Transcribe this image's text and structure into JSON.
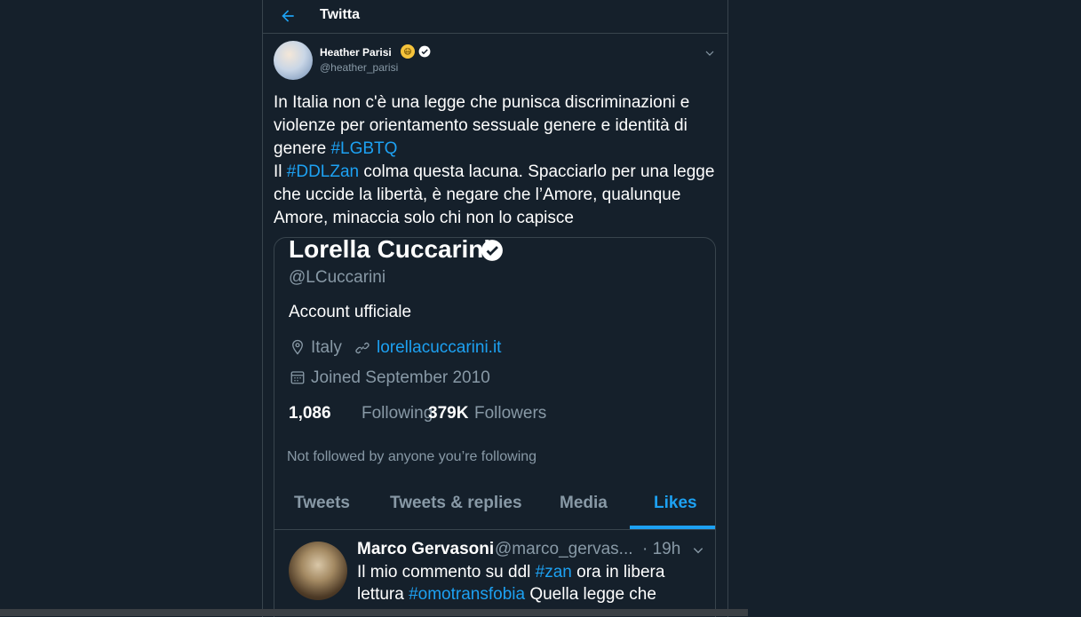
{
  "header": {
    "title": "Twitta"
  },
  "tweet": {
    "author_name": "Heather Parisi",
    "author_emoji": "😷",
    "author_handle": "@heather_parisi",
    "text": {
      "p1": "In Italia non c'è una legge che punisca discriminazioni e violenze per orientamento sessuale genere e identità di genere ",
      "h1": "#LGBTQ",
      "p2a": "Il ",
      "h2": "#DDLZan",
      "p2b": " colma questa lacuna. Spacciarlo per una legge che uccide la libertà, è negare che l’Amore, qualunque Amore, minaccia solo chi non lo capisce"
    }
  },
  "quoted_profile": {
    "name": "Lorella Cuccarini",
    "handle": "@LCuccarini",
    "bio": "Account ufficiale",
    "location": "Italy",
    "link": "lorellacuccarini.it",
    "joined": "Joined September 2010",
    "following_count": "1,086",
    "following_label": "Following",
    "followers_count": "379K",
    "followers_label": "Followers",
    "not_followed_text": "Not followed by anyone you’re following",
    "tabs": [
      "Tweets",
      "Tweets & replies",
      "Media",
      "Likes"
    ],
    "active_tab": "Likes"
  },
  "liked_tweet": {
    "name": "Marco Gervasoni",
    "handle": "@marco_gervas...",
    "time": "· 19h",
    "t1": "Il mio commento su ddl ",
    "h1": "#zan",
    "t2": " ora in libera lettura ",
    "h2": "#omotransfobia",
    "t3": " Quella legge che"
  },
  "colors": {
    "background": "#15202b",
    "accent": "#1da1f2",
    "secondary_text": "#8899a6",
    "border": "#38444d"
  }
}
